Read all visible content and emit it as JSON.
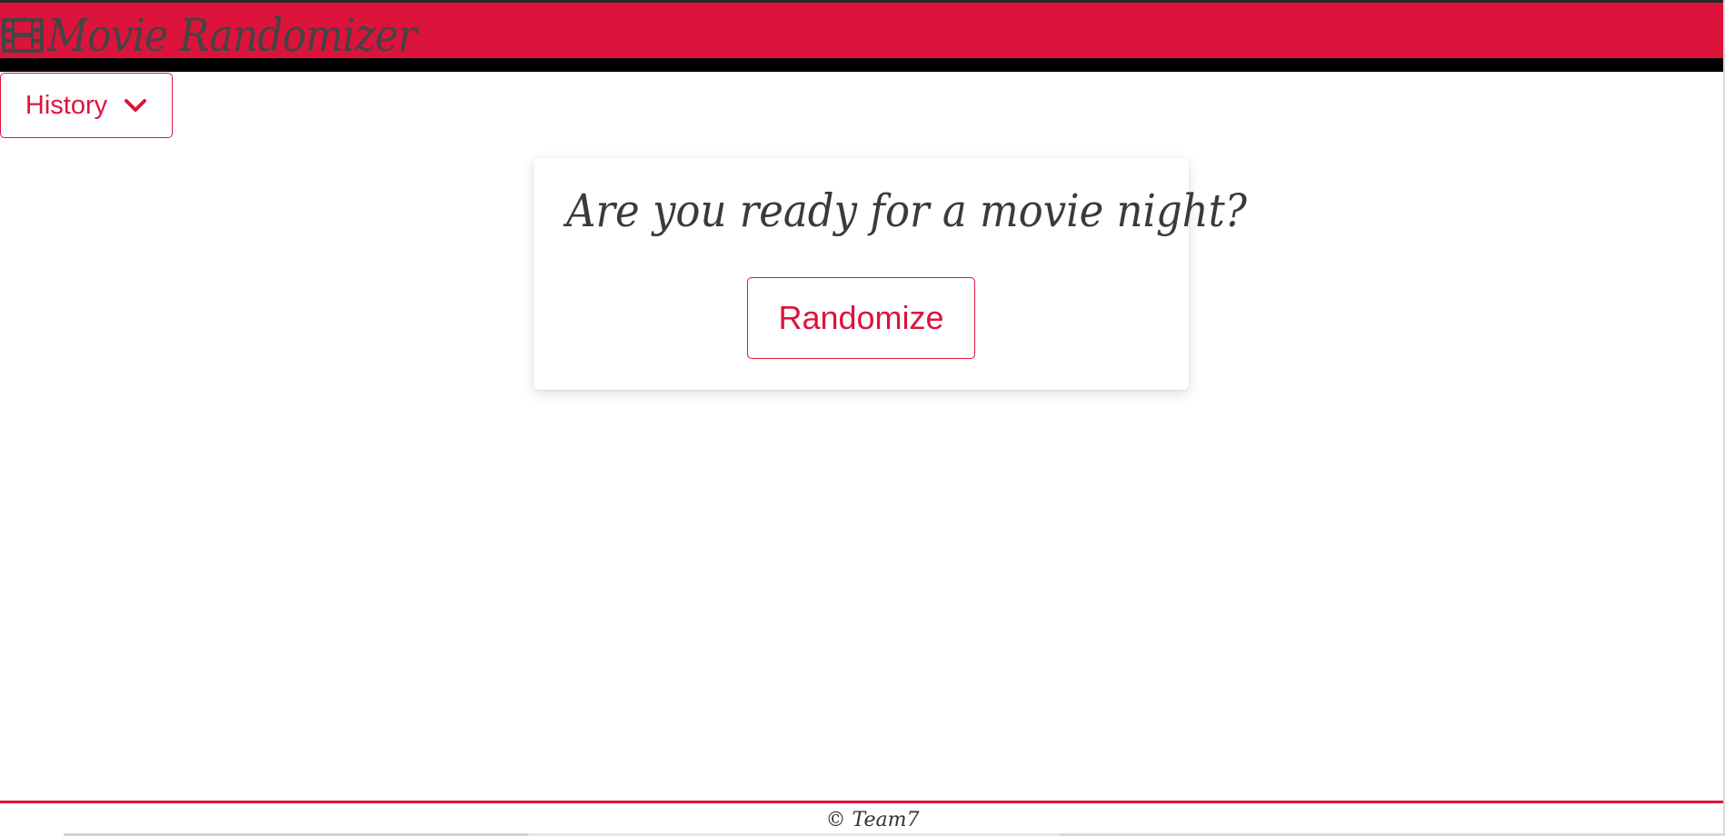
{
  "app": {
    "title": "Movie Randomizer",
    "brand_icon": "film-icon",
    "accent_color": "#dc143c"
  },
  "nav": {
    "history_label": "History",
    "history_icon": "chevron-down-icon"
  },
  "main": {
    "heading": "Are you ready for a movie night?",
    "randomize_label": "Randomize"
  },
  "footer": {
    "text": "© Team7"
  }
}
